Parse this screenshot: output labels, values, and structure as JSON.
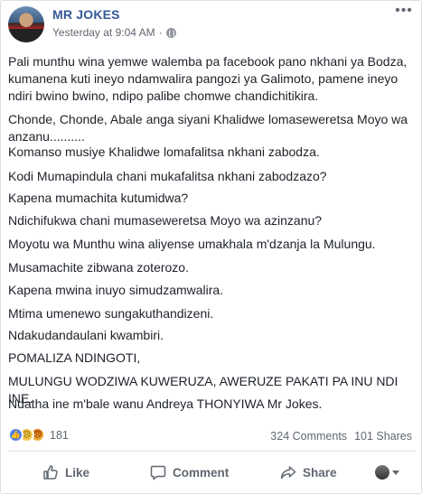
{
  "post": {
    "author": "MR JOKES",
    "timestamp": "Yesterday at 9:04 AM",
    "separator": "·",
    "privacy_icon": "globe-icon",
    "more_icon": "more-options-icon",
    "more_glyph": "•••",
    "paragraphs": [
      "Pali munthu wina yemwe walemba pa facebook pano nkhani ya Bodza, kumanena kuti ineyo ndamwalira pangozi ya Galimoto, pamene ineyo ndiri bwino bwino, ndipo palibe chomwe chandichitikira.",
      "Chonde, Chonde, Abale anga siyani Khalidwe lomaseweretsa Moyo wa anzanu..........",
      "Komanso musiye Khalidwe lomafalitsa nkhani zabodza.",
      "Kodi Mumapindula chani mukafalitsa nkhani zabodzazo?",
      "Kapena mumachita kutumidwa?",
      "Ndichifukwa chani mumaseweretsa Moyo wa azinzanu?",
      "Moyotu wa Munthu wina aliyense umakhala m'dzanja la Mulungu.",
      "Musamachite zibwana zoterozo.",
      "Kapena mwina inuyo simudzamwalira.",
      "Mtima umenewo sungakuthandizeni.",
      "Ndakudandaulani kwambiri.",
      "POMALIZA NDINGOTI,",
      "MULUNGU WODZIWA KUWERUZA, AWERUZE PAKATI PA INU NDI INE.",
      "Ndatha ine m'bale wanu Andreya THONYIWA Mr Jokes."
    ]
  },
  "stats": {
    "reaction_icons": [
      "like-reaction-icon",
      "sad-reaction-icon",
      "angry-reaction-icon"
    ],
    "reaction_count": "181",
    "comments": "324 Comments",
    "shares": "101 Shares"
  },
  "actions": {
    "like": "Like",
    "comment": "Comment",
    "share": "Share"
  },
  "colors": {
    "author_link": "#365899",
    "secondary_text": "#606770",
    "body_text": "#1d2129",
    "like_reaction": "#4a7ff0"
  }
}
